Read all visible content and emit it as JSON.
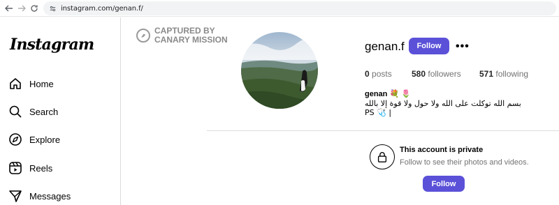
{
  "browser": {
    "url": "instagram.com/genan.f/"
  },
  "sidebar": {
    "logo": "Instagram",
    "items": [
      {
        "label": "Home",
        "icon": "home-icon"
      },
      {
        "label": "Search",
        "icon": "search-icon"
      },
      {
        "label": "Explore",
        "icon": "compass-icon"
      },
      {
        "label": "Reels",
        "icon": "reels-icon"
      },
      {
        "label": "Messages",
        "icon": "messages-icon"
      }
    ]
  },
  "watermark": {
    "line1": "CAPTURED BY",
    "line2": "CANARY MISSION"
  },
  "profile": {
    "username": "genan.f",
    "follow_label": "Follow",
    "more_label": "•••",
    "posts_count": "0",
    "posts_label": "posts",
    "followers_count": "580",
    "followers_label": "followers",
    "following_count": "571",
    "following_label": "following",
    "bio_name": "genan 💐 🌷",
    "bio_text": "بسم الله توكلت على الله ولا حول ولا قوة إلا بالله | 🩺 PS"
  },
  "private": {
    "title": "This account is private",
    "subtitle": "Follow to see their photos and videos.",
    "follow_label": "Follow"
  },
  "colors": {
    "accent": "#5b51d8",
    "border": "#dbdbdb",
    "muted": "#737373"
  }
}
